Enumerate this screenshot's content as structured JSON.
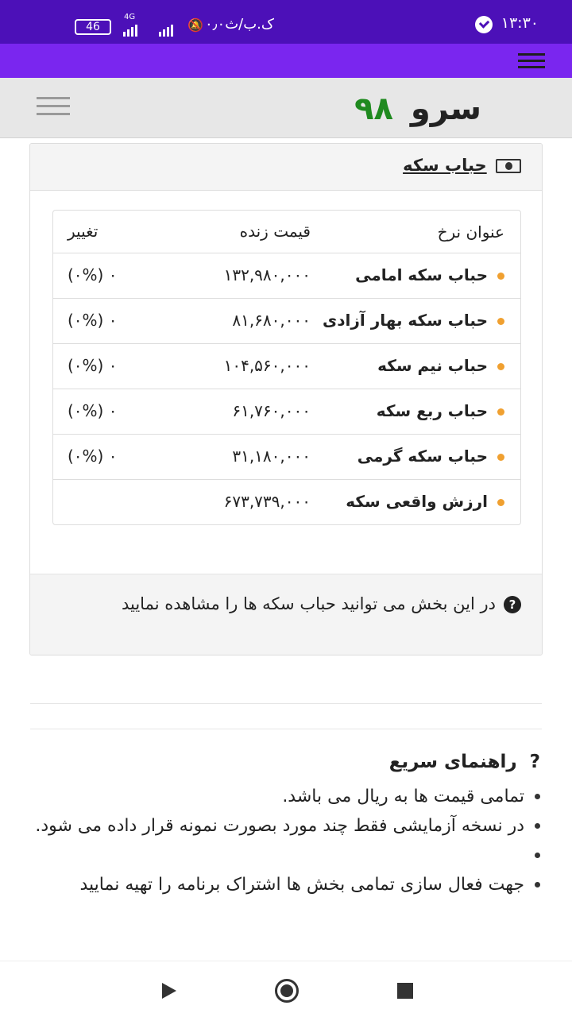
{
  "status_bar": {
    "time": "۱۳:۳۰",
    "net_speed": "۰٫۰ک.ب/ث",
    "lte": "4G",
    "battery": "46"
  },
  "header": {
    "logo_word": "سرو",
    "logo_number": "۹۸"
  },
  "panel": {
    "title": "حباب سکه",
    "columns": [
      "عنوان نرخ",
      "قیمت زنده",
      "تغییر"
    ],
    "rows": [
      {
        "name": "حباب سکه امامی",
        "price": "۱۳۲,۹۸۰,۰۰۰",
        "change": "(۰%) ۰"
      },
      {
        "name": "حباب سکه بهار آزادی",
        "price": "۸۱,۶۸۰,۰۰۰",
        "change": "(۰%) ۰"
      },
      {
        "name": "حباب نیم سکه",
        "price": "۱۰۴,۵۶۰,۰۰۰",
        "change": "(۰%) ۰"
      },
      {
        "name": "حباب ربع سکه",
        "price": "۶۱,۷۶۰,۰۰۰",
        "change": "(۰%) ۰"
      },
      {
        "name": "حباب سکه گرمی",
        "price": "۳۱,۱۸۰,۰۰۰",
        "change": "(۰%) ۰"
      },
      {
        "name": "ارزش واقعی سکه",
        "price": "۶۷۳,۷۳۹,۰۰۰",
        "change": ""
      }
    ],
    "note": "در این بخش می توانید حباب سکه ها را مشاهده نمایید"
  },
  "guide": {
    "title": "راهنمای سریع",
    "items": [
      "تمامی قیمت ها به ریال می باشد.",
      "در نسخه آزمایشی فقط چند مورد بصورت نمونه قرار داده می شود.",
      "",
      "جهت فعال سازی تمامی بخش ها اشتراک برنامه را تهیه نمایید"
    ]
  },
  "colors": {
    "status_bar": "#4c10b8",
    "app_bar": "#7a26ef",
    "logo_number": "#1f8a1f",
    "row_dot": "#f0a030"
  }
}
